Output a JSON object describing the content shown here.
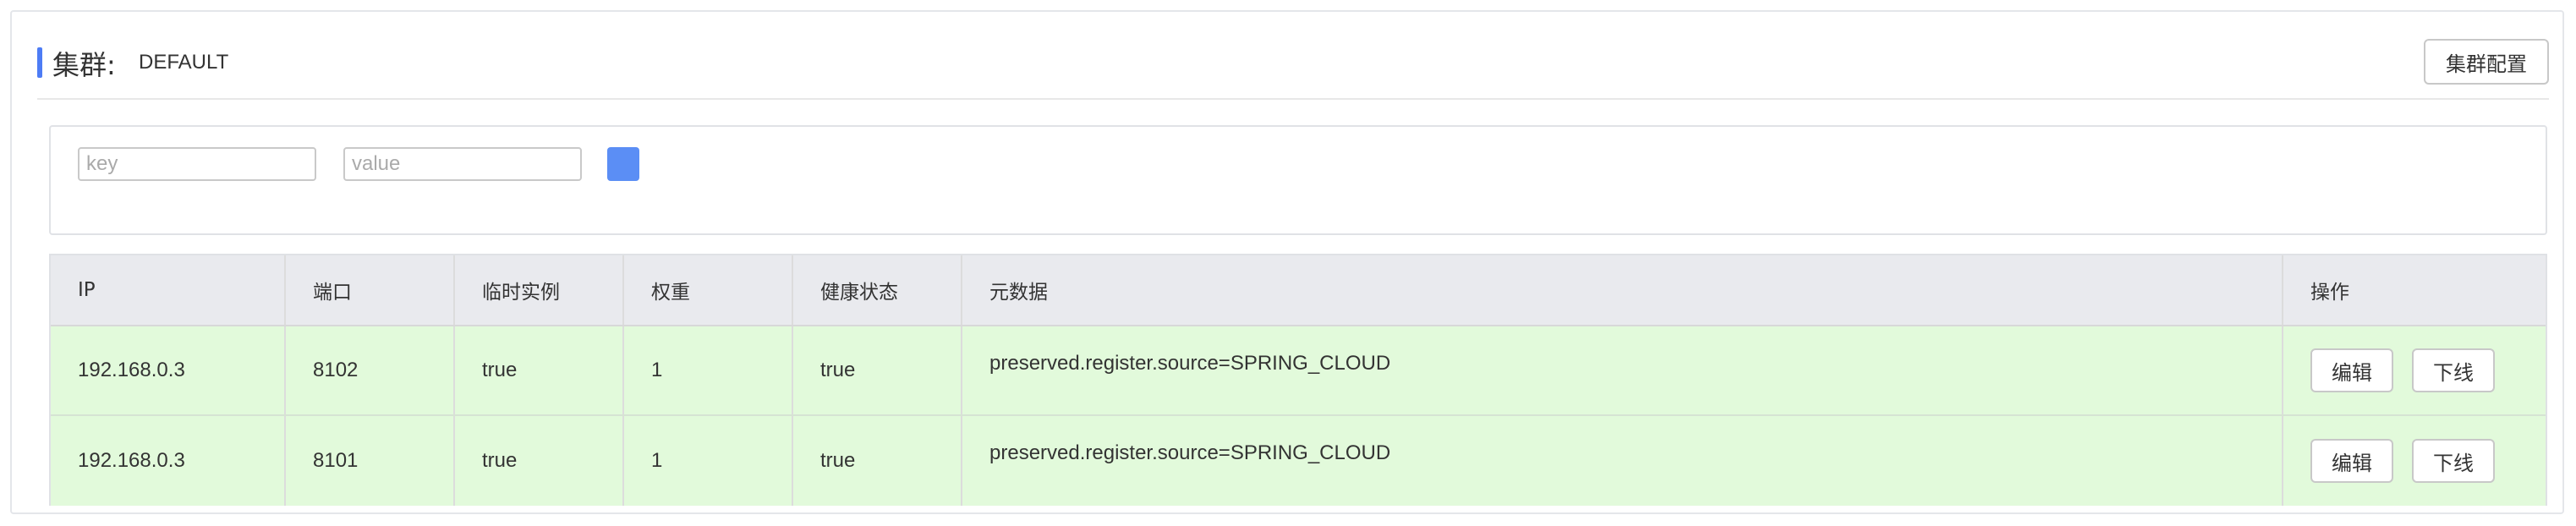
{
  "header": {
    "title_label": "集群:",
    "cluster_name": "DEFAULT",
    "cluster_config_button": "集群配置"
  },
  "filter": {
    "key_placeholder": "key",
    "value_placeholder": "value"
  },
  "colors": {
    "accent": "#4d7cf5",
    "search_button": "#5b8ef5",
    "row_background": "#e2fadb",
    "header_background": "#e9eaee"
  },
  "table": {
    "columns": [
      "IP",
      "端口",
      "临时实例",
      "权重",
      "健康状态",
      "元数据",
      "操作"
    ],
    "rows": [
      {
        "ip": "192.168.0.3",
        "port": "8102",
        "ephemeral": "true",
        "weight": "1",
        "healthy": "true",
        "metadata": "preserved.register.source=SPRING_CLOUD",
        "edit_label": "编辑",
        "offline_label": "下线"
      },
      {
        "ip": "192.168.0.3",
        "port": "8101",
        "ephemeral": "true",
        "weight": "1",
        "healthy": "true",
        "metadata": "preserved.register.source=SPRING_CLOUD",
        "edit_label": "编辑",
        "offline_label": "下线"
      }
    ]
  }
}
